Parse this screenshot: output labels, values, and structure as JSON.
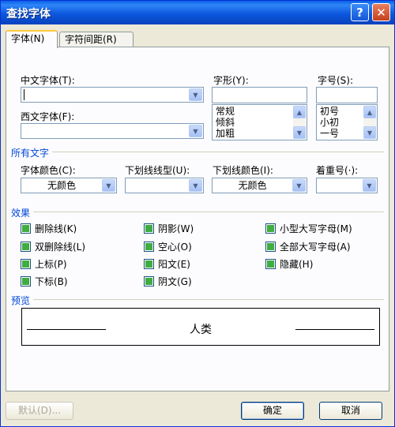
{
  "window": {
    "title": "查找字体",
    "help_glyph": "?",
    "close_glyph": "✕"
  },
  "tabs": [
    {
      "label": "字体(N)"
    },
    {
      "label": "字符间距(R)"
    }
  ],
  "font": {
    "chinese_font_label": "中文字体(T):",
    "chinese_font_value": "",
    "western_font_label": "西文字体(F):",
    "western_font_value": "",
    "style_label": "字形(Y):",
    "style_value": "",
    "style_options": [
      "常规",
      "倾斜",
      "加粗"
    ],
    "size_label": "字号(S):",
    "size_value": "",
    "size_options": [
      "初号",
      "小初",
      "一号"
    ]
  },
  "all_text": {
    "group_label": "所有文字",
    "color_label": "字体颜色(C):",
    "color_value": "无颜色",
    "underline_label": "下划线线型(U):",
    "underline_value": "",
    "underline_color_label": "下划线颜色(I):",
    "underline_color_value": "无颜色",
    "emphasis_label": "着重号(·):",
    "emphasis_value": ""
  },
  "effects": {
    "group_label": "效果",
    "items": [
      "删除线(K)",
      "双删除线(L)",
      "上标(P)",
      "下标(B)",
      "阴影(W)",
      "空心(O)",
      "阳文(E)",
      "阴文(G)",
      "小型大写字母(M)",
      "全部大写字母(A)",
      "隐藏(H)"
    ]
  },
  "preview": {
    "group_label": "预览",
    "sample": "人类"
  },
  "buttons": {
    "default": "默认(D)...",
    "ok": "确定",
    "cancel": "取消"
  },
  "colors": {
    "title_bar": "#0a5fe6",
    "group_label": "#0046d5",
    "checkbox_fill": "#3fad3f",
    "dialog_bg": "#ece9d8"
  }
}
